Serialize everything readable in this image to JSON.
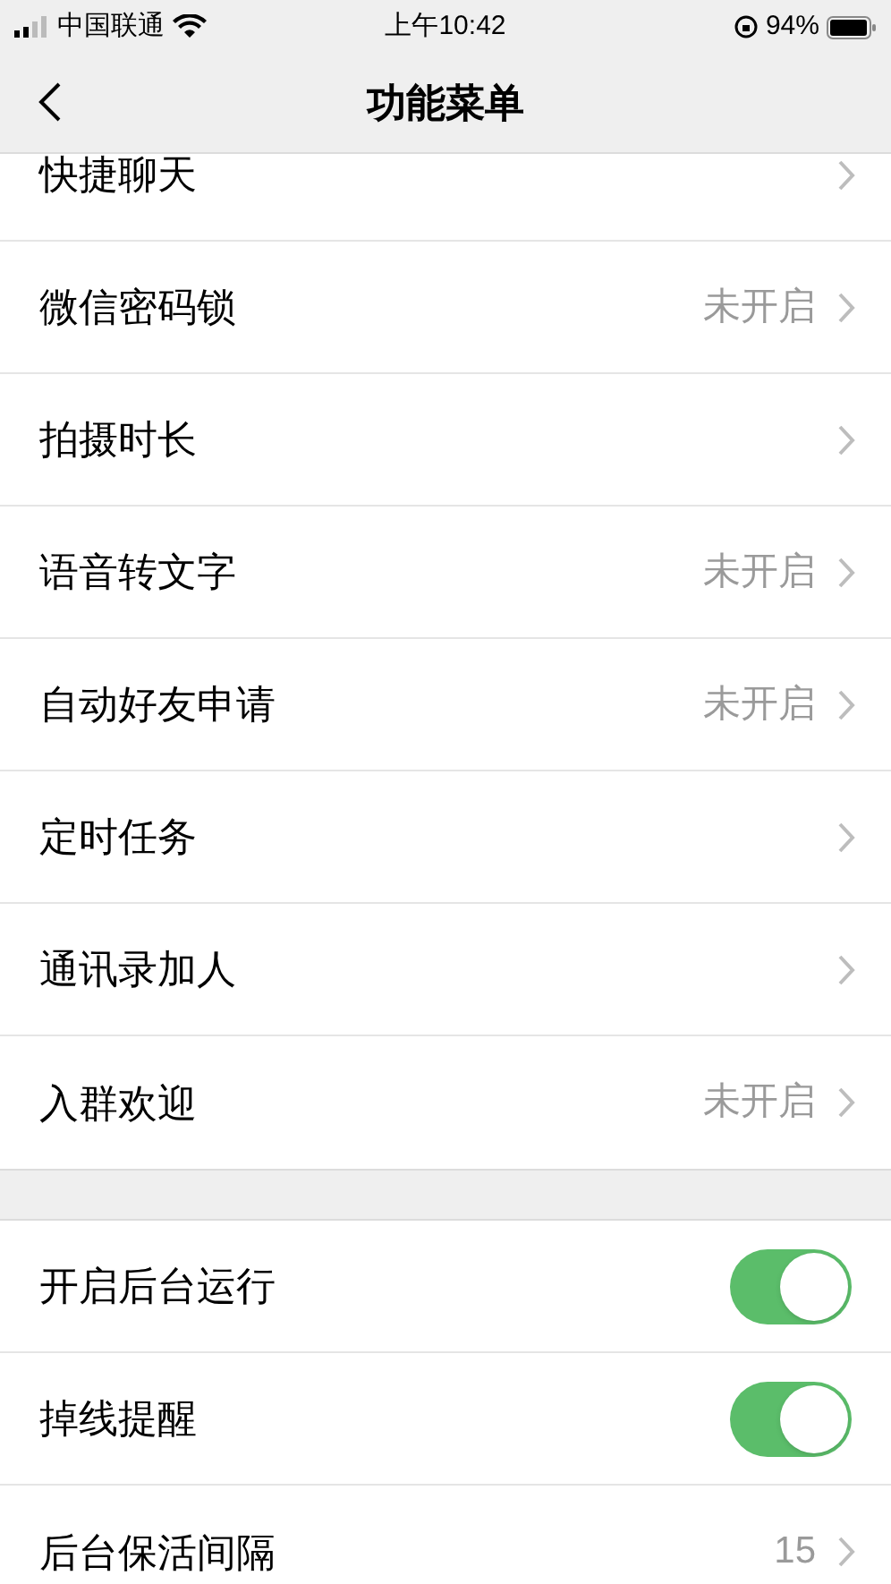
{
  "status_bar": {
    "carrier": "中国联通",
    "time": "上午10:42",
    "battery": "94%"
  },
  "nav": {
    "title": "功能菜单"
  },
  "groups": [
    {
      "items": [
        {
          "kind": "link",
          "label": "快捷聊天"
        },
        {
          "kind": "link",
          "label": "微信密码锁",
          "value": "未开启"
        },
        {
          "kind": "link",
          "label": "拍摄时长"
        },
        {
          "kind": "link",
          "label": "语音转文字",
          "value": "未开启"
        },
        {
          "kind": "link",
          "label": "自动好友申请",
          "value": "未开启"
        },
        {
          "kind": "link",
          "label": "定时任务"
        },
        {
          "kind": "link",
          "label": "通讯录加人"
        },
        {
          "kind": "link",
          "label": "入群欢迎",
          "value": "未开启"
        }
      ]
    },
    {
      "items": [
        {
          "kind": "toggle",
          "label": "开启后台运行",
          "on": true
        },
        {
          "kind": "toggle",
          "label": "掉线提醒",
          "on": true
        },
        {
          "kind": "link",
          "label": "后台保活间隔",
          "value": "15"
        }
      ]
    }
  ]
}
